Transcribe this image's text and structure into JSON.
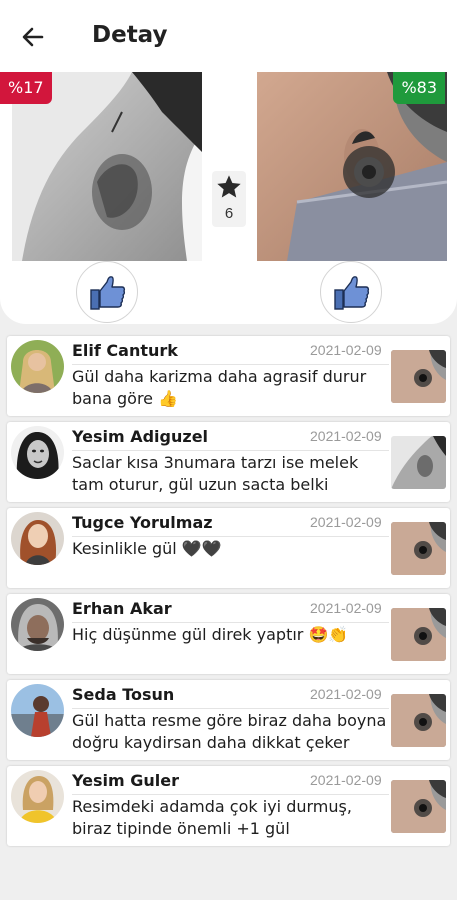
{
  "appbar": {
    "title": "Detay",
    "back_icon": "arrow-left-icon"
  },
  "compare": {
    "left": {
      "percent": "%17",
      "percent_color": "#d2163c"
    },
    "right": {
      "percent": "%83",
      "percent_color": "#1f9a3c"
    },
    "vote": {
      "icon": "star-icon",
      "count": "6"
    },
    "like_icon": "thumbs-up-icon"
  },
  "comments": [
    {
      "name": "Elif Canturk",
      "date": "2021-02-09",
      "text": "Gül daha karizma daha agrasif durur bana göre 👍",
      "choice": "right"
    },
    {
      "name": "Yesim Adiguzel",
      "date": "2021-02-09",
      "text": "Saclar kısa 3numara tarzı ise melek tam oturur, gül uzun sacta belki",
      "choice": "left"
    },
    {
      "name": "Tugce Yorulmaz",
      "date": "2021-02-09",
      "text": "Kesinlikle gül 🖤🖤",
      "choice": "right"
    },
    {
      "name": "Erhan Akar",
      "date": "2021-02-09",
      "text": "Hiç düşünme gül direk yaptır 🤩👏",
      "choice": "right"
    },
    {
      "name": "Seda Tosun",
      "date": "2021-02-09",
      "text": "Gül hatta resme göre biraz daha boyna doğru kaydirsan daha dikkat çeker",
      "choice": "right"
    },
    {
      "name": "Yesim Guler",
      "date": "2021-02-09",
      "text": "Resimdeki adamda çok iyi durmuş, biraz tipinde önemli +1 gül",
      "choice": "right"
    }
  ]
}
